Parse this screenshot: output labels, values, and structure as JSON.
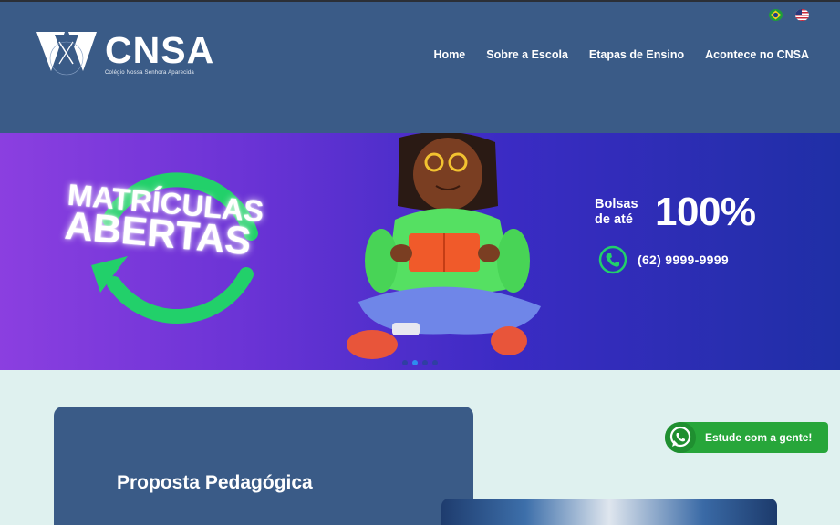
{
  "header": {
    "logo_title": "CNSA",
    "logo_subtitle": "Colégio Nossa Senhora Aparecida",
    "nav": [
      "Home",
      "Sobre a Escola",
      "Etapas de Ensino",
      "Acontece no CNSA"
    ],
    "flags": [
      "brazil-flag-icon",
      "usa-flag-icon"
    ]
  },
  "banner": {
    "headline_1": "MATRÍCULAS",
    "headline_2": "ABERTAS",
    "bolsas_line1": "Bolsas",
    "bolsas_line2": "de até",
    "bolsas_value": "100%",
    "phone": "(62) 9999-9999",
    "slides": 4,
    "active_slide": 2
  },
  "content": {
    "card_title": "Proposta Pedagógica"
  },
  "whatsapp": {
    "label": "Estude com a gente!"
  },
  "colors": {
    "header_bg": "#3a5b87",
    "page_bg": "#dff1ef",
    "accent_green": "#27a63a",
    "banner_ring": "#22d06a"
  }
}
